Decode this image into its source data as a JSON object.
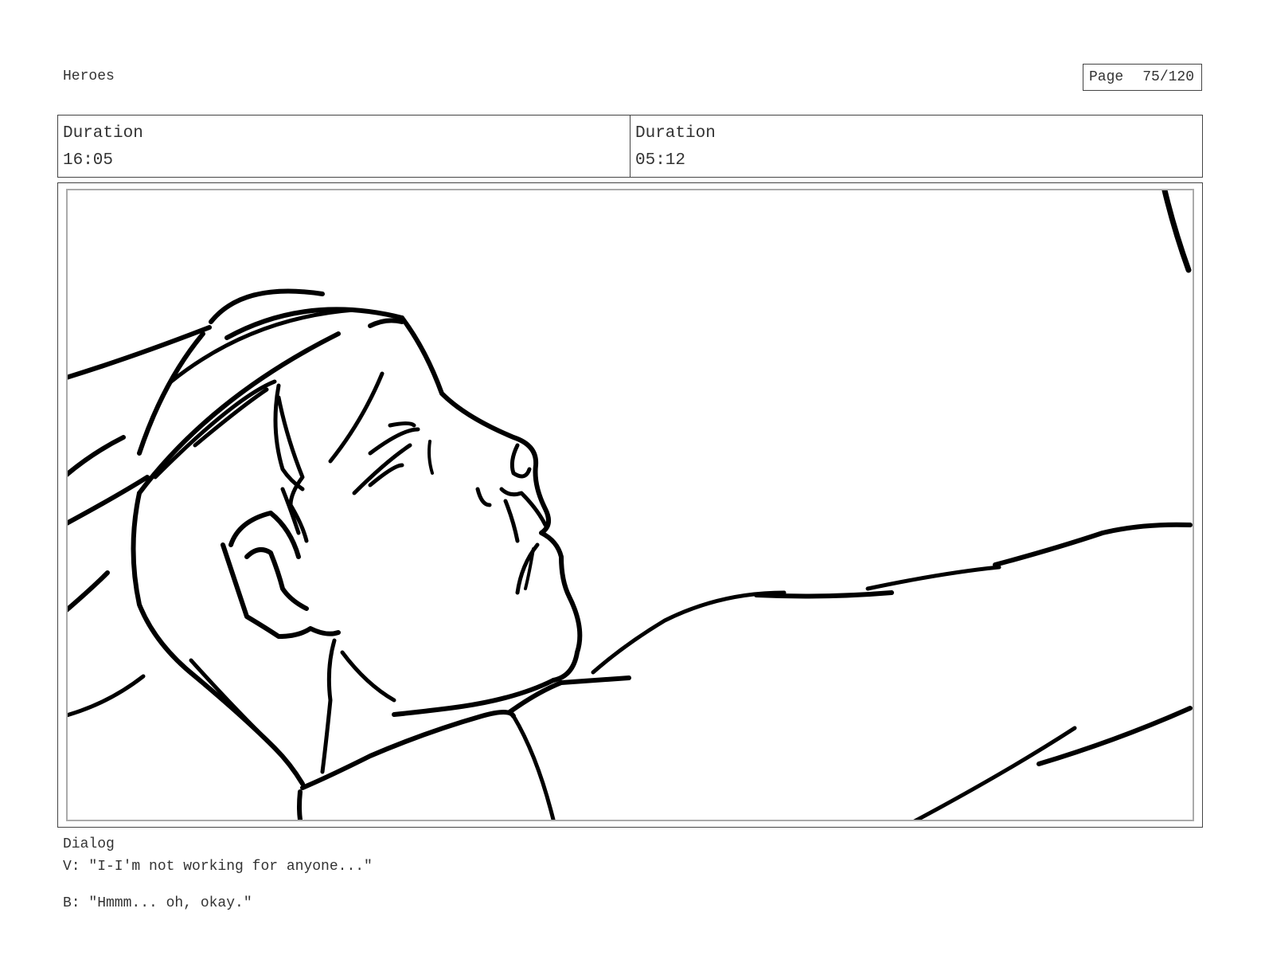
{
  "header": {
    "title": "Heroes",
    "page_label": "Page",
    "page_number": "75/120"
  },
  "durations": [
    {
      "label": "Duration",
      "value": "16:05"
    },
    {
      "label": "Duration",
      "value": "05:12"
    }
  ],
  "panel": {
    "sketch": "sketch-illustration"
  },
  "dialog": {
    "heading": "Dialog",
    "lines": [
      "V: \"I-I'm not working for anyone...\"",
      "B: \"Hmmm... oh, okay.\""
    ]
  }
}
